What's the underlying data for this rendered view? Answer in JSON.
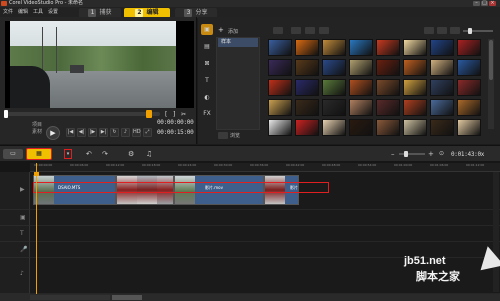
{
  "titlebar": {
    "title": "Corel VideoStudio Pro - 未命名",
    "icon": "corel-app-icon",
    "buttons": [
      "minimize",
      "maximize",
      "close"
    ]
  },
  "menubar": {
    "items": [
      "文件",
      "编辑",
      "工具",
      "设置"
    ]
  },
  "steps": {
    "tabs": [
      {
        "num": "1",
        "label": "捕获",
        "active": false
      },
      {
        "num": "2",
        "label": "编辑",
        "active": true
      },
      {
        "num": "3",
        "label": "分享",
        "active": false
      }
    ]
  },
  "preview": {
    "mode_top": "项目",
    "mode_bottom": "素材",
    "timecode_left": "00:00:00:00",
    "timecode_right": "00:00:15:00",
    "scrub_fraction": 0.95
  },
  "library": {
    "add_label": "添加",
    "folder": "样本",
    "browse_label": "浏览",
    "side_icons": [
      "media-icon",
      "instant-project-icon",
      "transition-icon",
      "title-icon",
      "graphic-icon",
      "filter-icon"
    ],
    "fx_label": "FX",
    "thumb_rows": [
      [
        "#3a5f9e",
        "#d86a12",
        "#c08a3a",
        "#2a78c0",
        "#c83a20",
        "#f0d8a0",
        "#224488",
        "#aa2222"
      ],
      [
        "#3a2a5a",
        "#5a3a1a",
        "#2a4a8a",
        "#b0a070",
        "#6a2010",
        "#c06020",
        "#d0b080",
        "#2a5aa0"
      ],
      [
        "#c0301a",
        "#2a2a6a",
        "#5a7a3a",
        "#b05020",
        "#7a4a2a",
        "#d0a040",
        "#304060",
        "#8a2a2a"
      ],
      [
        "#caa050",
        "#3a2a1a",
        "#2a2a2a",
        "#b08060",
        "#5a2a2a",
        "#b04020",
        "#4a6a9a",
        "#aa6a2a"
      ],
      [
        "#e8e8e8",
        "#cc2222",
        "#e6d0b0",
        "#2a1a10",
        "#8a5a3a",
        "#ccc0a0",
        "#3a2a1a",
        "#e0c8a0"
      ]
    ]
  },
  "timeline": {
    "total_time": "0:01:43:0x",
    "ruler_ticks": [
      "00:00:00:00",
      "00:00:06:00",
      "00:00:12:00",
      "00:00:18:00",
      "00:00:24:00",
      "00:00:30:00",
      "00:00:36:00",
      "00:00:42:00",
      "00:00:48:00",
      "00:00:54:00",
      "00:01:00:00",
      "00:01:06:00",
      "00:01:12:00"
    ],
    "clips": [
      {
        "label": "DSAIO.MTS"
      },
      {
        "label": "影片.mov"
      },
      {
        "label": "影片"
      }
    ]
  },
  "watermark": {
    "site": "jb51.net",
    "cn": "脚本之家"
  }
}
